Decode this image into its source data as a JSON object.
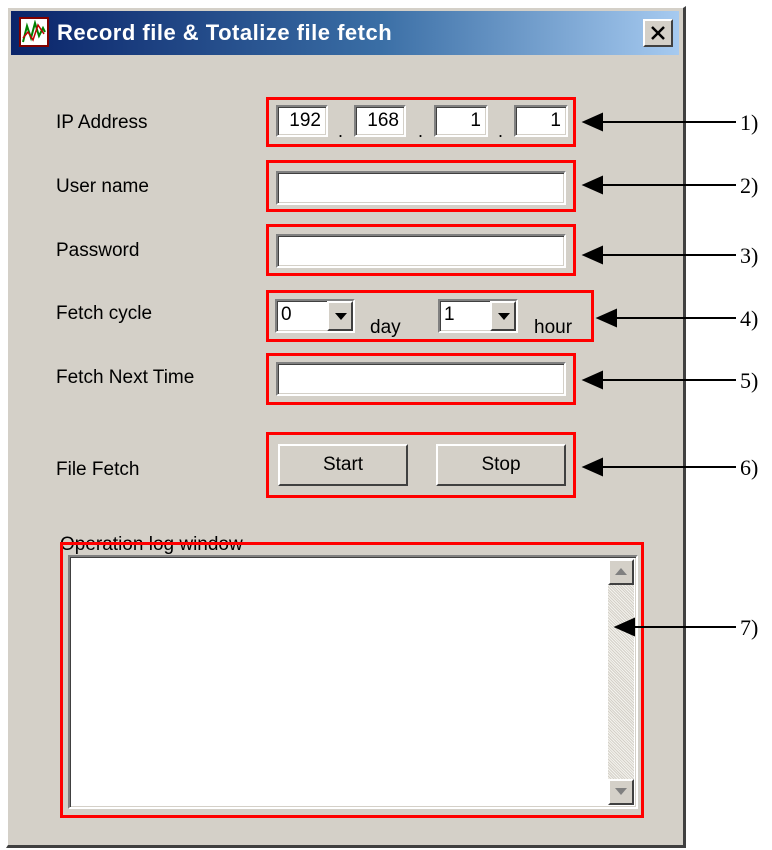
{
  "window": {
    "title": "Record file & Totalize file fetch"
  },
  "icons": {
    "app": "chart-line-icon",
    "close": "close-icon",
    "dropdown": "chevron-down-icon",
    "scroll_up": "arrow-up-icon",
    "scroll_down": "arrow-down-icon"
  },
  "form": {
    "ip_label": "IP Address",
    "ip": [
      "192",
      "168",
      "1",
      "1"
    ],
    "username_label": "User name",
    "username_value": "",
    "password_label": "Password",
    "password_value": "",
    "cycle_label": "Fetch cycle",
    "cycle_day_value": "0",
    "cycle_day_unit": "day",
    "cycle_hour_value": "1",
    "cycle_hour_unit": "hour",
    "next_label": "Fetch Next Time",
    "next_value": "",
    "fetch_label": "File Fetch",
    "start_label": "Start",
    "stop_label": "Stop",
    "log_label": "Operation log window",
    "log_text": ""
  },
  "callouts": [
    "1)",
    "2)",
    "3)",
    "4)",
    "5)",
    "6)",
    "7)"
  ],
  "colors": {
    "highlight": "#ff0000",
    "window_bg": "#d4d0c8",
    "title_start": "#0a246a",
    "title_end": "#a6caf0"
  }
}
